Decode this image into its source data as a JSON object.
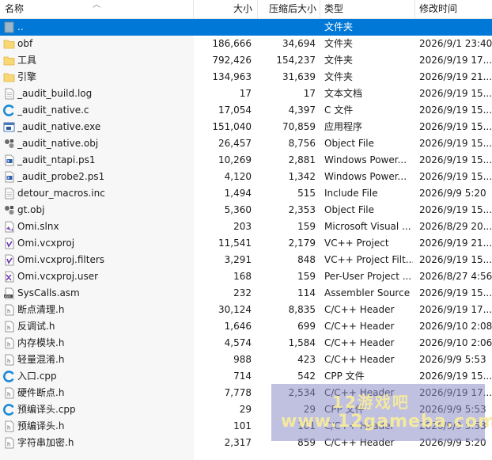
{
  "columns": {
    "name": "名称",
    "size": "大小",
    "compressed": "压缩后大小",
    "type": "类型",
    "modified": "修改时间"
  },
  "rows": [
    {
      "name": "..",
      "size": "",
      "compressed": "",
      "type": "文件夹",
      "date": "",
      "icon": "folder-up-icon"
    },
    {
      "name": "obf",
      "size": "186,666",
      "compressed": "34,694",
      "type": "文件夹",
      "date": "2026/9/1 23:40",
      "icon": "folder-icon"
    },
    {
      "name": "工具",
      "size": "792,426",
      "compressed": "154,237",
      "type": "文件夹",
      "date": "2026/9/19 17...",
      "icon": "folder-icon"
    },
    {
      "name": "引擎",
      "size": "134,963",
      "compressed": "31,639",
      "type": "文件夹",
      "date": "2026/9/19 21...",
      "icon": "folder-icon"
    },
    {
      "name": "_audit_build.log",
      "size": "17",
      "compressed": "17",
      "type": "文本文档",
      "date": "2026/9/19 15...",
      "icon": "text-file-icon"
    },
    {
      "name": "_audit_native.c",
      "size": "17,054",
      "compressed": "4,397",
      "type": "C 文件",
      "date": "2026/9/19 15...",
      "icon": "c-file-icon"
    },
    {
      "name": "_audit_native.exe",
      "size": "151,040",
      "compressed": "70,859",
      "type": "应用程序",
      "date": "2026/9/19 15...",
      "icon": "exe-icon"
    },
    {
      "name": "_audit_native.obj",
      "size": "26,457",
      "compressed": "8,756",
      "type": "Object File",
      "date": "2026/9/19 15...",
      "icon": "obj-file-icon"
    },
    {
      "name": "_audit_ntapi.ps1",
      "size": "10,269",
      "compressed": "2,881",
      "type": "Windows Power...",
      "date": "2026/9/19 15...",
      "icon": "powershell-icon"
    },
    {
      "name": "_audit_probe2.ps1",
      "size": "4,120",
      "compressed": "1,342",
      "type": "Windows Power...",
      "date": "2026/9/19 15...",
      "icon": "powershell-icon"
    },
    {
      "name": "detour_macros.inc",
      "size": "1,494",
      "compressed": "515",
      "type": "Include File",
      "date": "2026/9/9 5:20",
      "icon": "text-file-icon"
    },
    {
      "name": "gt.obj",
      "size": "5,360",
      "compressed": "2,353",
      "type": "Object File",
      "date": "2026/9/19 15...",
      "icon": "obj-file-icon"
    },
    {
      "name": "Omi.slnx",
      "size": "203",
      "compressed": "159",
      "type": "Microsoft Visual ...",
      "date": "2026/8/29 20...",
      "icon": "vs-solution-icon"
    },
    {
      "name": "Omi.vcxproj",
      "size": "11,541",
      "compressed": "2,179",
      "type": "VC++ Project",
      "date": "2026/9/19 21...",
      "icon": "vcxproj-icon"
    },
    {
      "name": "Omi.vcxproj.filters",
      "size": "3,291",
      "compressed": "848",
      "type": "VC++ Project Filt...",
      "date": "2026/9/19 15...",
      "icon": "vcxproj-icon"
    },
    {
      "name": "Omi.vcxproj.user",
      "size": "168",
      "compressed": "159",
      "type": "Per-User Project ...",
      "date": "2026/8/27 4:56",
      "icon": "vs-user-icon"
    },
    {
      "name": "SysCalls.asm",
      "size": "232",
      "compressed": "114",
      "type": "Assembler Source",
      "date": "2026/9/19 15...",
      "icon": "asm-file-icon"
    },
    {
      "name": "断点清理.h",
      "size": "30,124",
      "compressed": "8,835",
      "type": "C/C++ Header",
      "date": "2026/9/19 17...",
      "icon": "header-file-icon"
    },
    {
      "name": "反调试.h",
      "size": "1,646",
      "compressed": "699",
      "type": "C/C++ Header",
      "date": "2026/9/10 2:08",
      "icon": "header-file-icon"
    },
    {
      "name": "内存模块.h",
      "size": "4,574",
      "compressed": "1,584",
      "type": "C/C++ Header",
      "date": "2026/9/10 2:06",
      "icon": "header-file-icon"
    },
    {
      "name": "轻量混淆.h",
      "size": "988",
      "compressed": "423",
      "type": "C/C++ Header",
      "date": "2026/9/9 5:53",
      "icon": "header-file-icon"
    },
    {
      "name": "入口.cpp",
      "size": "714",
      "compressed": "542",
      "type": "CPP 文件",
      "date": "2026/9/19 15...",
      "icon": "cpp-file-icon"
    },
    {
      "name": "硬件断点.h",
      "size": "7,778",
      "compressed": "2,534",
      "type": "C/C++ Header",
      "date": "2026/9/19 17...",
      "icon": "header-file-icon"
    },
    {
      "name": "预编译头.cpp",
      "size": "29",
      "compressed": "29",
      "type": "CPP 文件",
      "date": "2026/9/9 5:53",
      "icon": "cpp-file-icon"
    },
    {
      "name": "预编译头.h",
      "size": "101",
      "compressed": "101",
      "type": "C/C++ Header",
      "date": "2026/9/9 5:53",
      "icon": "header-file-icon"
    },
    {
      "name": "字符串加密.h",
      "size": "2,317",
      "compressed": "859",
      "type": "C/C++ Header",
      "date": "2026/9/9 5:20",
      "icon": "header-file-icon"
    }
  ],
  "watermark": {
    "line1": "12游戏吧",
    "line2": "www.12gameba.com"
  },
  "colors": {
    "selection": "#0078d7",
    "folder": "#f8d775",
    "header_border": "#e5e5e5"
  }
}
